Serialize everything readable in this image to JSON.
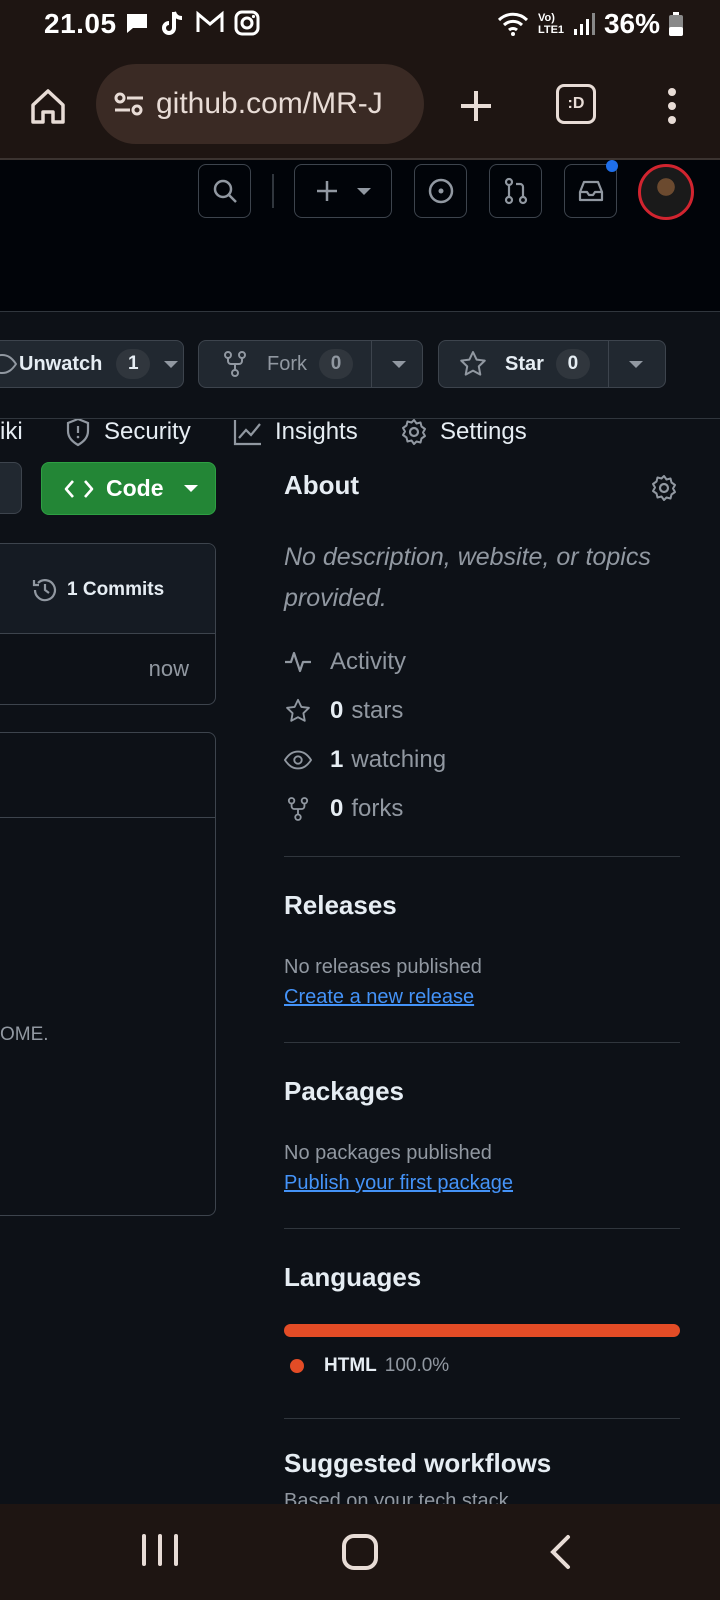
{
  "status_bar": {
    "time": "21.05",
    "network": "Vo) LTE1",
    "battery": "36%"
  },
  "browser": {
    "url": "github.com/MR-J",
    "tab_badge": ":D"
  },
  "repo_nav": {
    "wiki_fragment": "iki",
    "security": "Security",
    "insights": "Insights",
    "settings": "Settings"
  },
  "actions": {
    "unwatch_label": "Unwatch",
    "unwatch_count": "1",
    "fork_label": "Fork",
    "fork_count": "0",
    "star_label": "Star",
    "star_count": "0"
  },
  "code_button": {
    "label": "Code"
  },
  "commits": {
    "label": "1 Commits",
    "time": "now"
  },
  "readme_fragment": "OME.",
  "about": {
    "title": "About",
    "description": "No description, website, or topics provided.",
    "activity": "Activity",
    "stars_count": "0",
    "stars_label": "stars",
    "watching_count": "1",
    "watching_label": "watching",
    "forks_count": "0",
    "forks_label": "forks"
  },
  "releases": {
    "title": "Releases",
    "empty": "No releases published",
    "link": "Create a new release"
  },
  "packages": {
    "title": "Packages",
    "empty": "No packages published",
    "link": "Publish your first package"
  },
  "languages": {
    "title": "Languages",
    "items": [
      {
        "name": "HTML",
        "percent": "100.0%",
        "fraction": 1.0,
        "color": "#e34c26"
      }
    ]
  },
  "suggested": {
    "title": "Suggested workflows",
    "subtitle": "Based on your tech stack"
  }
}
